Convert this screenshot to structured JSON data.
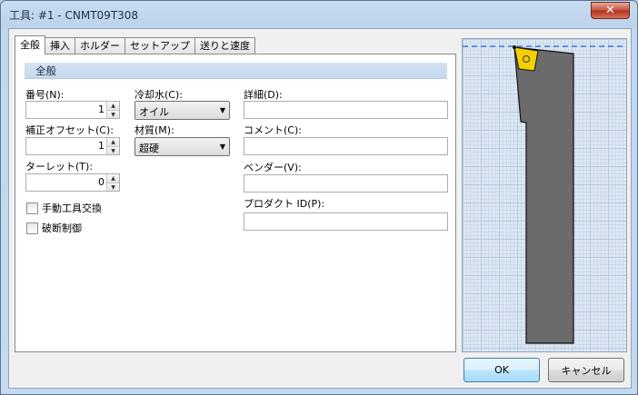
{
  "window": {
    "title": "工具: #1 - CNMT09T308",
    "close_glyph": "✕"
  },
  "tabs": [
    {
      "label": "全般",
      "active": true
    },
    {
      "label": "挿入",
      "active": false
    },
    {
      "label": "ホルダー",
      "active": false
    },
    {
      "label": "セットアップ",
      "active": false
    },
    {
      "label": "送りと速度",
      "active": false
    }
  ],
  "section": {
    "title": "全般"
  },
  "fields": {
    "number": {
      "label": "番号(N):",
      "value": "1"
    },
    "comp_offset": {
      "label": "補正オフセット(C):",
      "value": "1"
    },
    "turret": {
      "label": "ターレット(T):",
      "value": "0"
    },
    "coolant": {
      "label": "冷却水(C):",
      "value": "オイル"
    },
    "material": {
      "label": "材質(M):",
      "value": "超硬"
    },
    "detail": {
      "label": "詳細(D):",
      "value": ""
    },
    "comment": {
      "label": "コメント(C):",
      "value": ""
    },
    "vendor": {
      "label": "ベンダー(V):",
      "value": ""
    },
    "product_id": {
      "label": "プロダクト ID(P):",
      "value": ""
    }
  },
  "checkboxes": {
    "manual_tool_change": {
      "label": "手動工具交換",
      "checked": false
    },
    "breakage_control": {
      "label": "破断制御",
      "checked": false
    }
  },
  "buttons": {
    "ok": "OK",
    "cancel": "キャンセル"
  },
  "colors": {
    "insert": "#f5d000",
    "holder": "#6b6b6b",
    "centerline": "#3b74d8",
    "grid": "#dde8f5"
  }
}
